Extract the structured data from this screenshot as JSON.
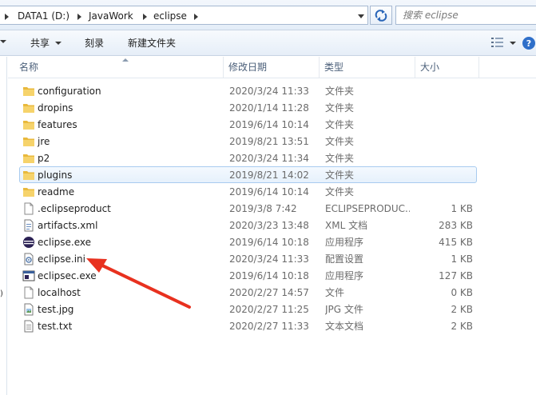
{
  "address_bar": {
    "crumbs": [
      "DATA1 (D:)",
      "JavaWork",
      "eclipse"
    ]
  },
  "search": {
    "placeholder": "搜索 eclipse"
  },
  "toolbar": {
    "share_label": "共享",
    "burn_label": "刻录",
    "new_folder_label": "新建文件夹"
  },
  "columns": {
    "name": "名称",
    "date": "修改日期",
    "type": "类型",
    "size": "大小"
  },
  "files": [
    {
      "name": "configuration",
      "date": "2020/3/24 11:33",
      "type": "文件夹",
      "size": "",
      "icon": "folder-icon"
    },
    {
      "name": "dropins",
      "date": "2020/1/14 11:28",
      "type": "文件夹",
      "size": "",
      "icon": "folder-icon"
    },
    {
      "name": "features",
      "date": "2019/6/14 10:14",
      "type": "文件夹",
      "size": "",
      "icon": "folder-icon"
    },
    {
      "name": "jre",
      "date": "2019/8/21 13:51",
      "type": "文件夹",
      "size": "",
      "icon": "folder-icon"
    },
    {
      "name": "p2",
      "date": "2020/3/24 11:34",
      "type": "文件夹",
      "size": "",
      "icon": "folder-icon"
    },
    {
      "name": "plugins",
      "date": "2019/8/21 14:02",
      "type": "文件夹",
      "size": "",
      "icon": "folder-icon"
    },
    {
      "name": "readme",
      "date": "2019/6/14 10:14",
      "type": "文件夹",
      "size": "",
      "icon": "folder-icon"
    },
    {
      "name": ".eclipseproduct",
      "date": "2019/3/8 7:42",
      "type": "ECLIPSEPRODUC...",
      "size": "1 KB",
      "icon": "blank-file-icon"
    },
    {
      "name": "artifacts.xml",
      "date": "2020/3/23 13:48",
      "type": "XML 文档",
      "size": "283 KB",
      "icon": "xml-file-icon"
    },
    {
      "name": "eclipse.exe",
      "date": "2019/6/14 10:18",
      "type": "应用程序",
      "size": "415 KB",
      "icon": "eclipse-icon"
    },
    {
      "name": "eclipse.ini",
      "date": "2020/3/24 11:33",
      "type": "配置设置",
      "size": "1 KB",
      "icon": "config-file-icon"
    },
    {
      "name": "eclipsec.exe",
      "date": "2019/6/14 10:18",
      "type": "应用程序",
      "size": "127 KB",
      "icon": "console-exe-icon"
    },
    {
      "name": "localhost",
      "date": "2020/2/27 14:57",
      "type": "文件",
      "size": "0 KB",
      "icon": "blank-file-icon"
    },
    {
      "name": "test.jpg",
      "date": "2020/2/27 11:25",
      "type": "JPG 文件",
      "size": "2 KB",
      "icon": "image-file-icon"
    },
    {
      "name": "test.txt",
      "date": "2020/2/27 11:33",
      "type": "文本文档",
      "size": "2 KB",
      "icon": "text-file-icon"
    }
  ],
  "hover_row": "plugins",
  "annotation": {
    "color": "#e8311f",
    "points_to": "eclipse.ini"
  },
  "nav_glyph": ")"
}
